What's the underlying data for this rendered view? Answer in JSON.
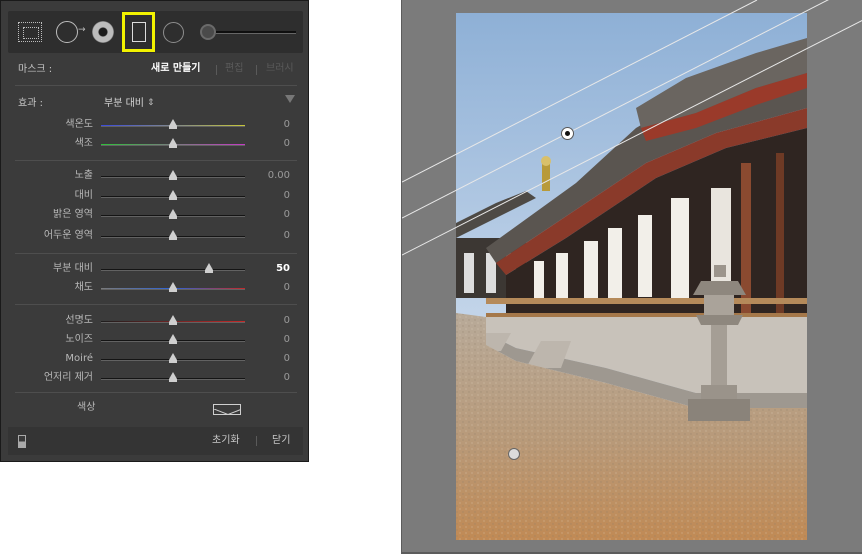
{
  "panel": {
    "tools": [
      {
        "name": "crop-overlay-icon"
      },
      {
        "name": "spot-removal-icon"
      },
      {
        "name": "red-eye-icon"
      },
      {
        "name": "graduated-filter-icon",
        "selected": true
      },
      {
        "name": "radial-filter-icon"
      },
      {
        "name": "adjustment-brush-icon"
      }
    ],
    "highlight_color": "#f2f200",
    "mask": {
      "label": "마스크 :",
      "new": "새로 만들기",
      "edit": "편집",
      "brush": "브러시"
    },
    "effect": {
      "label": "효과 :",
      "value": "부분 대비",
      "arrows": "⇕"
    },
    "sliders": [
      {
        "label": "색온도",
        "value": "0",
        "position": 0.5,
        "gradient": "temp"
      },
      {
        "label": "색조",
        "value": "0",
        "position": 0.5,
        "gradient": "tint"
      },
      {
        "label": "노출",
        "value": "0.00",
        "position": 0.5
      },
      {
        "label": "대비",
        "value": "0",
        "position": 0.5
      },
      {
        "label": "밝은 영역",
        "value": "0",
        "position": 0.5
      },
      {
        "label": "어두운 영역",
        "value": "0",
        "position": 0.5
      },
      {
        "label": "부분 대비",
        "value": "50",
        "position": 0.75,
        "active": true
      },
      {
        "label": "채도",
        "value": "0",
        "position": 0.5,
        "gradient": "saturation"
      },
      {
        "label": "선명도",
        "value": "0",
        "position": 0.5,
        "gradient": "sharpness"
      },
      {
        "label": "노이즈",
        "value": "0",
        "position": 0.5
      },
      {
        "label": "Moiré",
        "value": "0",
        "position": 0.5
      },
      {
        "label": "언저리 제거",
        "value": "0",
        "position": 0.5
      }
    ],
    "color_label": "색상",
    "reset": "초기화",
    "close": "닫기"
  }
}
